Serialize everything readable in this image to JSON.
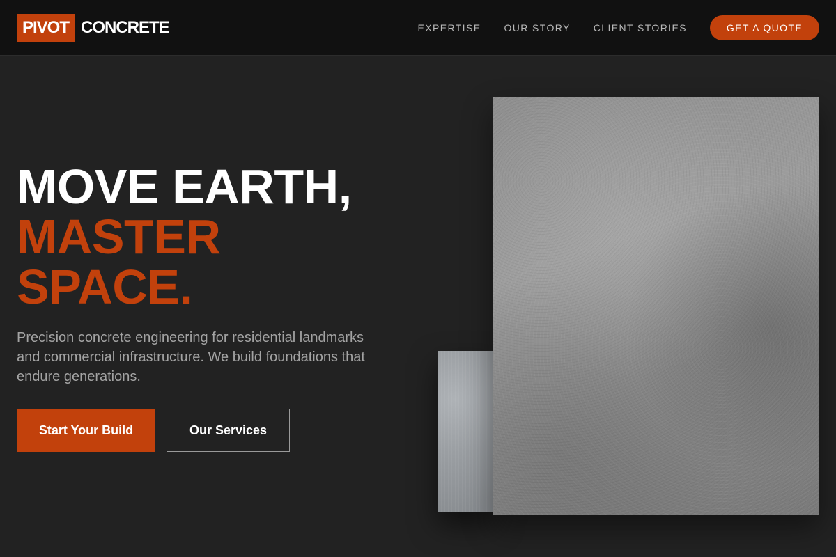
{
  "brand": {
    "mark": "PIVOT",
    "word": "CONCRETE",
    "accent_color": "#c2410c"
  },
  "nav": {
    "links": [
      "EXPERTISE",
      "OUR STORY",
      "CLIENT STORIES"
    ],
    "cta_label": "GET A QUOTE"
  },
  "hero": {
    "heading_line1": "MOVE EARTH,",
    "heading_line2": "MASTER",
    "heading_line3": "SPACE.",
    "subtitle": "Precision concrete engineering for residential landmarks and commercial infrastructure. We build foundations that endure generations.",
    "primary_button": "Start Your Build",
    "secondary_button": "Our Services"
  },
  "images": {
    "large": "concrete-texture-image",
    "small": "concrete-wall-image"
  }
}
